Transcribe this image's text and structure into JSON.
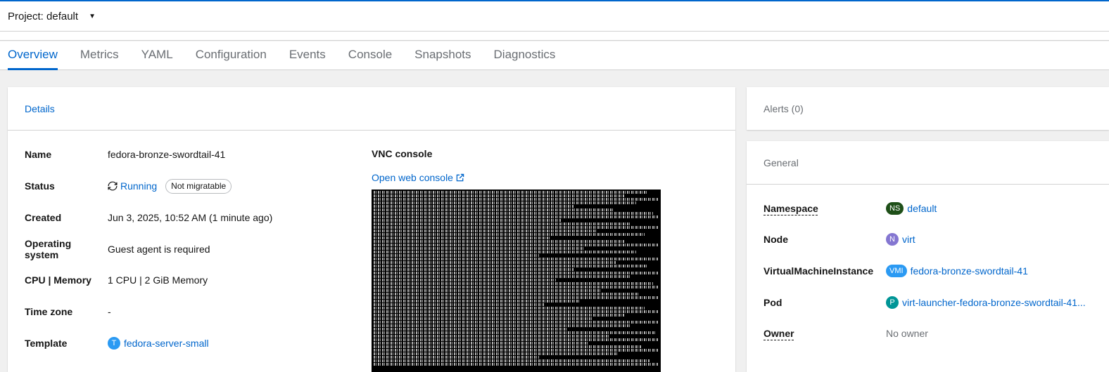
{
  "project": {
    "label": "Project: default"
  },
  "tabs": [
    {
      "label": "Overview"
    },
    {
      "label": "Metrics"
    },
    {
      "label": "YAML"
    },
    {
      "label": "Configuration"
    },
    {
      "label": "Events"
    },
    {
      "label": "Console"
    },
    {
      "label": "Snapshots"
    },
    {
      "label": "Diagnostics"
    }
  ],
  "details": {
    "title": "Details",
    "name_label": "Name",
    "name_value": "fedora-bronze-swordtail-41",
    "status_label": "Status",
    "status_value": "Running",
    "status_badge": "Not migratable",
    "created_label": "Created",
    "created_value": "Jun 3, 2025, 10:52 AM (1 minute ago)",
    "os_label": "Operating system",
    "os_value": "Guest agent is required",
    "cpu_label": "CPU | Memory",
    "cpu_value": "1 CPU | 2 GiB Memory",
    "tz_label": "Time zone",
    "tz_value": "-",
    "template_label": "Template",
    "template_badge": "T",
    "template_value": "fedora-server-small",
    "vnc_title": "VNC console",
    "vnc_link": "Open web console"
  },
  "alerts": {
    "title": "Alerts (0)"
  },
  "general": {
    "title": "General",
    "namespace_label": "Namespace",
    "namespace_badge": "NS",
    "namespace_value": "default",
    "node_label": "Node",
    "node_badge": "N",
    "node_value": "virt",
    "vmi_label": "VirtualMachineInstance",
    "vmi_badge": "VMI",
    "vmi_value": "fedora-bronze-swordtail-41",
    "pod_label": "Pod",
    "pod_badge": "P",
    "pod_value": "virt-launcher-fedora-bronze-swordtail-41...",
    "owner_label": "Owner",
    "owner_value": "No owner"
  },
  "colors": {
    "accent": "#0066cc",
    "template_badge": "#2b9af3",
    "namespace_badge": "#1e4f18",
    "node_badge": "#8476d1",
    "vmi_badge": "#2b9af3",
    "pod_badge": "#009596"
  }
}
